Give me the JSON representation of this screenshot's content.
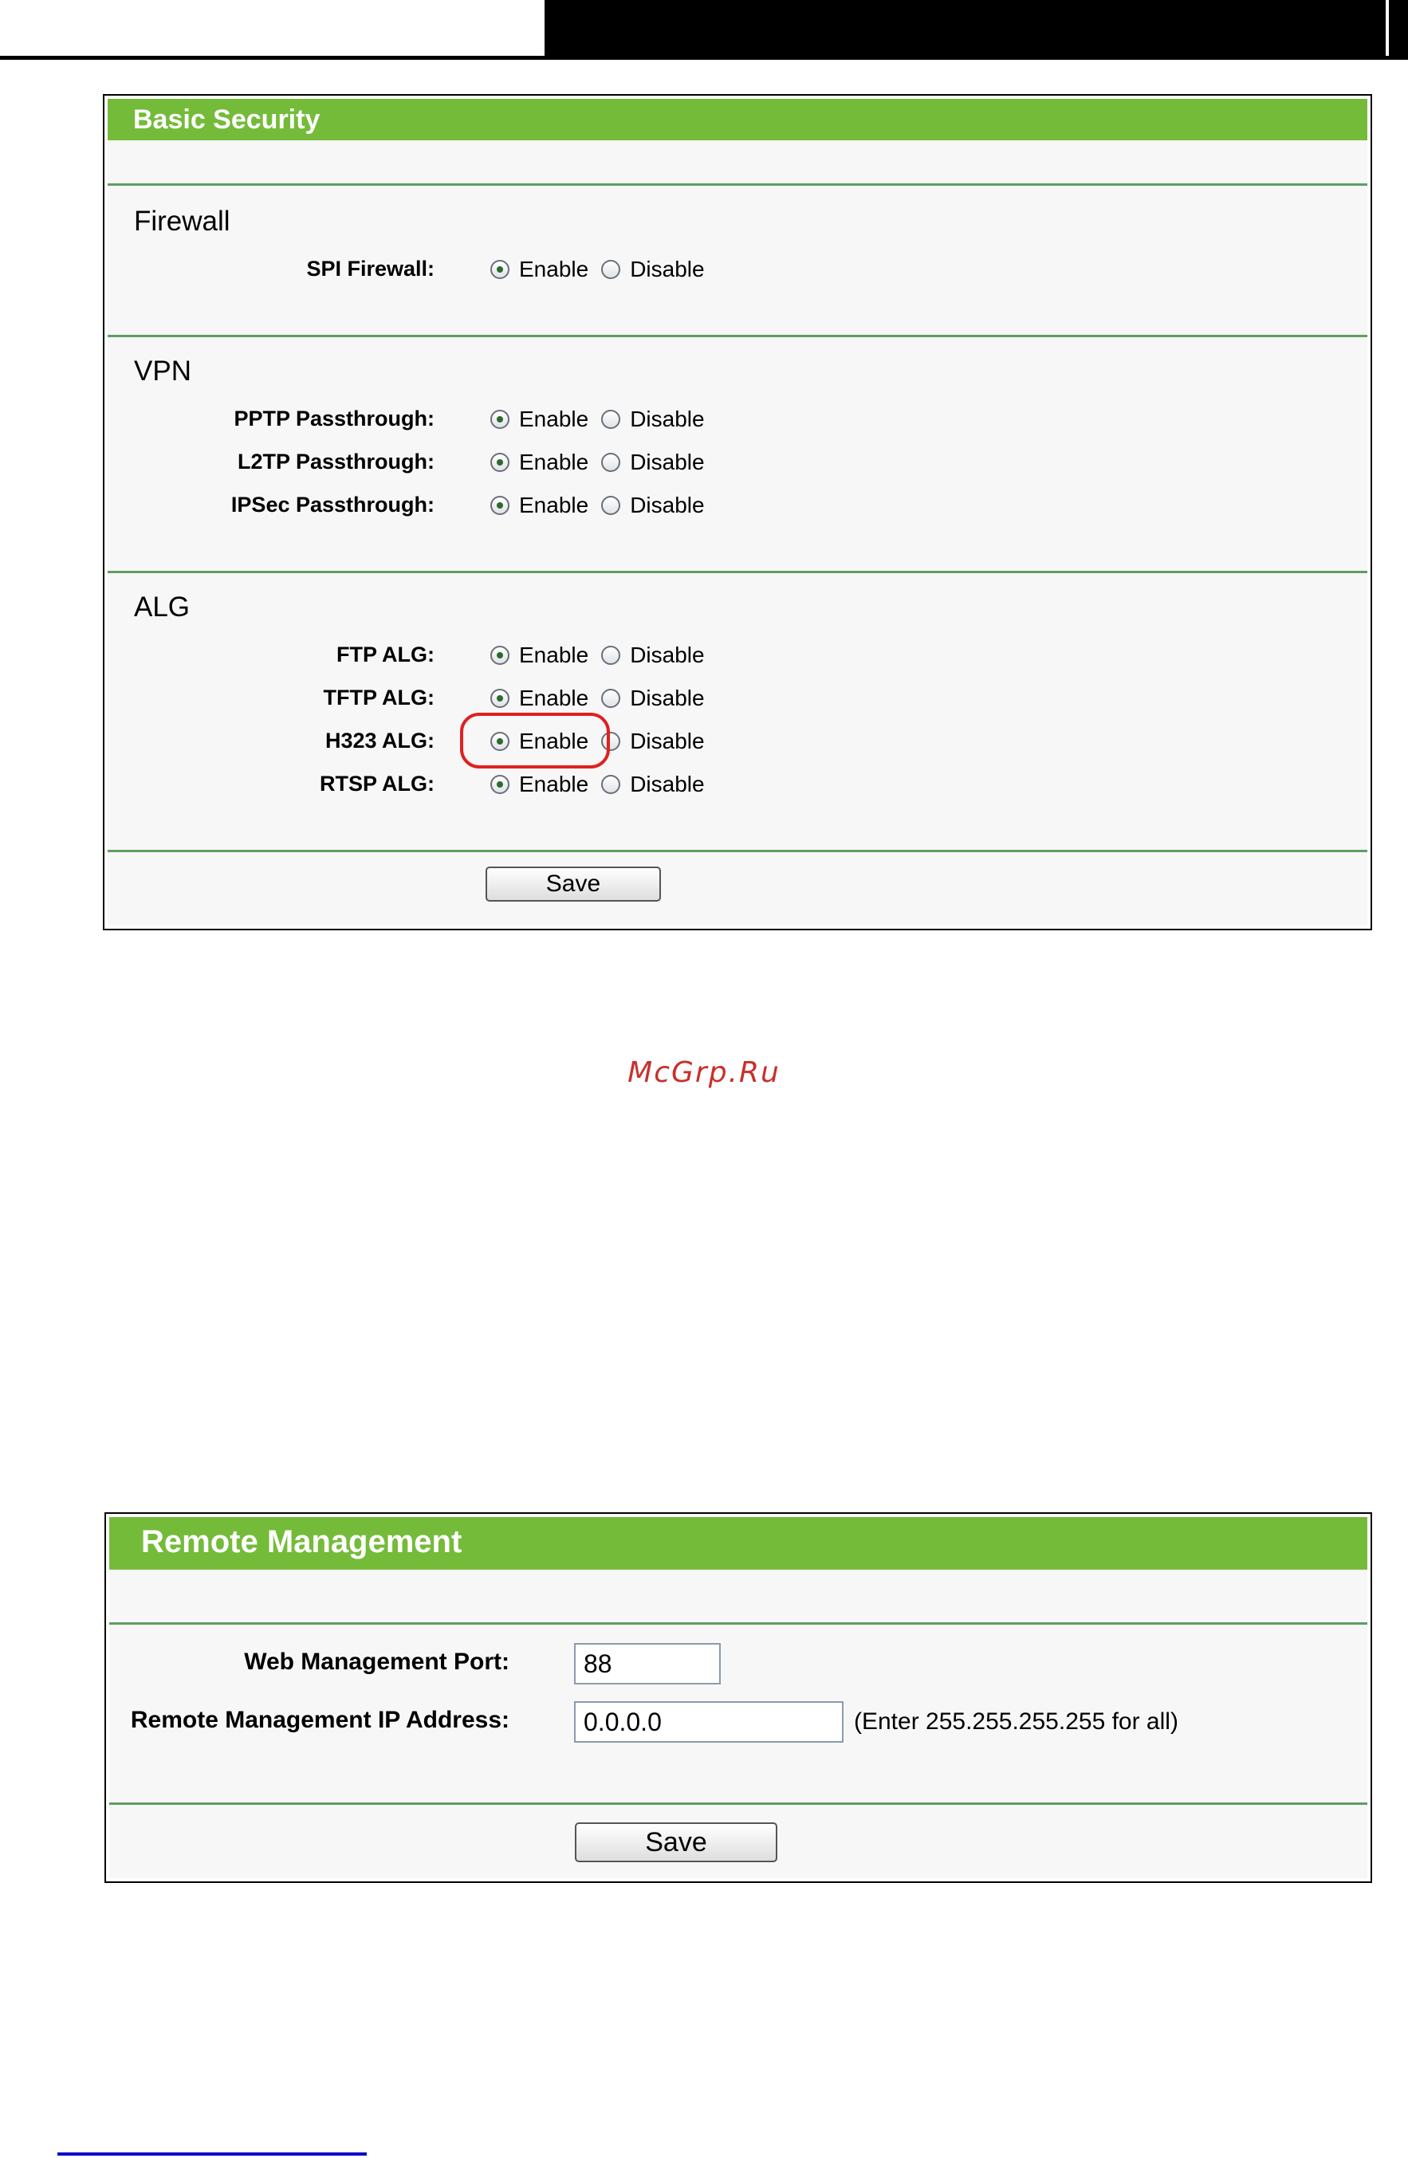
{
  "basic_security": {
    "title": "Basic Security",
    "firewall": {
      "title": "Firewall",
      "rows": [
        {
          "label": "SPI Firewall:",
          "value": "Enable"
        }
      ]
    },
    "vpn": {
      "title": "VPN",
      "rows": [
        {
          "label": "PPTP Passthrough:",
          "value": "Enable"
        },
        {
          "label": "L2TP Passthrough:",
          "value": "Enable"
        },
        {
          "label": "IPSec Passthrough:",
          "value": "Enable"
        }
      ]
    },
    "alg": {
      "title": "ALG",
      "rows": [
        {
          "label": "FTP ALG:",
          "value": "Enable"
        },
        {
          "label": "TFTP ALG:",
          "value": "Enable"
        },
        {
          "label": "H323 ALG:",
          "value": "Enable",
          "highlighted": true
        },
        {
          "label": "RTSP ALG:",
          "value": "Enable"
        }
      ]
    },
    "options": {
      "enable": "Enable",
      "disable": "Disable"
    },
    "save_label": "Save"
  },
  "watermark": "McGrp.Ru",
  "remote_management": {
    "title": "Remote Management",
    "port_label": "Web Management Port:",
    "port_value": "88",
    "ip_label": "Remote Management IP Address:",
    "ip_value": "0.0.0.0",
    "ip_hint": "(Enter 255.255.255.255 for all)",
    "save_label": "Save"
  },
  "colors": {
    "header_green": "#75bb3a",
    "separator": "#5e9e62",
    "highlight": "#e02020",
    "watermark": "#c8302b"
  }
}
